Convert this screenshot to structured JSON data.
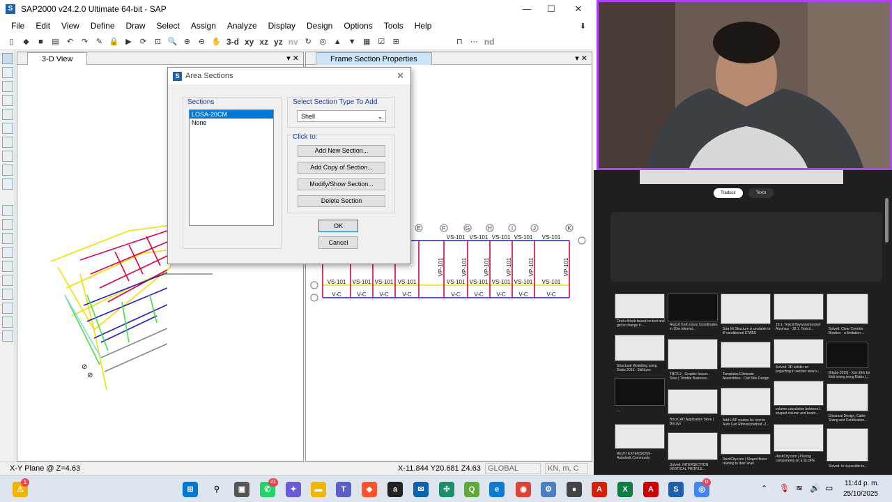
{
  "sap": {
    "title": "SAP2000 v24.2.0 Ultimate 64-bit - SAP",
    "logo_letter": "S",
    "window_controls": {
      "minimize": "—",
      "maximize": "☐",
      "close": "✕"
    },
    "menu": [
      "File",
      "Edit",
      "View",
      "Define",
      "Draw",
      "Select",
      "Assign",
      "Analyze",
      "Display",
      "Design",
      "Options",
      "Tools",
      "Help"
    ],
    "toolbar_text": {
      "view3d": "3-d",
      "xy": "xy",
      "xz": "xz",
      "yz": "yz",
      "nv": "nv",
      "nd": "nd"
    },
    "views": {
      "left_title": "3-D View",
      "right_title": "Frame Section Properties"
    },
    "status": {
      "plane": "X-Y Plane @ Z=4.63",
      "coords": "X-11.844  Y20.681  Z4.63",
      "coord_sys": "GLOBAL",
      "units": "KN, m, C"
    }
  },
  "dialog": {
    "title": "Area Sections",
    "sections_label": "Sections",
    "sections": [
      "LOSA-20CM",
      "None"
    ],
    "selected_section": "LOSA-20CM",
    "type_label": "Select Section Type To Add",
    "type_value": "Shell",
    "click_label": "Click to:",
    "buttons": {
      "add_new": "Add New Section...",
      "add_copy": "Add Copy of Section...",
      "modify": "Modify/Show Section...",
      "delete": "Delete Section",
      "ok": "OK",
      "cancel": "Cancel"
    }
  },
  "elevation": {
    "grid_labels": [
      "E",
      "F",
      "G",
      "H",
      "I",
      "J",
      "K"
    ],
    "beam_top": [
      "VS-101",
      "VS-101",
      "VS-101",
      "VS-101",
      "VS-101",
      "VS-101"
    ],
    "beam_mid": [
      "VS-101",
      "VS-101",
      "VS-101",
      "VS-101",
      "VS-101",
      "VS-101",
      "VS-101",
      "VS-101",
      "VS-101",
      "VS-101"
    ],
    "column_label": "VP-101",
    "bottom_label": "V-C",
    "level_mark": "~"
  },
  "browser": {
    "chips": [
      "Traducir",
      "Texto"
    ],
    "results": [
      "Find a Block based on text and get to change it -...",
      "Report Kerb Lines Coordinates in 10m Interval...",
      "Sửa lỗi Structure is unstable or ill-conditioned ETABS",
      "18.1. Tesicil Beyannamesinin Alınması - 18.1. Tesicil...",
      "Solved: Clear Corridor Bowties - a limitation-...",
      "Structural Modelling using Etabs 2016 : SkillLync",
      "TBC5.2 - Graphic Issues - Slow | Trimble Business...",
      "Templates Eliminate Assemblies - Civil Site Design",
      "Solved: 3D solids not projecting in section view a...",
      "[Etabs-2015] - Xác định tải khối lượng trong Etabs |...",
      "...",
      "BricsCAD Application Store | Bricsys",
      "Add LISP routine As Icon to Auto Cad Ribbon(method -2...",
      "volume calculation between L shaped column and beam...",
      "Electrical Design, Cable Sizing and Certification...",
      "REVIT EXTENSIONS - Autodesk Community",
      "Solved: INTERSECTION VERTICAL PROFILE...",
      "RevitCity.com | Sloped floors relating to their level",
      "RevitCity.com | Placing components on a SLOPE",
      "Solved: Is it possible to..."
    ]
  },
  "taskbar": {
    "time": "11:44 p. m.",
    "date": "25/10/2025",
    "badge_whatsapp": "21",
    "badge_warning": "1",
    "badge_chrome": "D"
  },
  "colors": {
    "sap_blue": "#1e5fae",
    "select_blue": "#0078d7",
    "webcam_border": "#b040ff",
    "frame_red": "#e0003a",
    "frame_blue": "#2020c0",
    "frame_yellow": "#f0e000"
  }
}
